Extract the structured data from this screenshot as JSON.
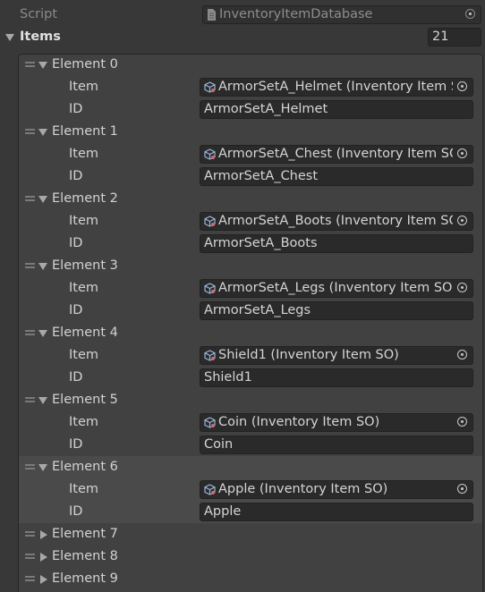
{
  "script": {
    "label": "Script",
    "value": "InventoryItemDatabase"
  },
  "items": {
    "label": "Items",
    "count": "21"
  },
  "elements": [
    {
      "header": "Element 0",
      "item_label": "Item",
      "item_value": "ArmorSetA_Helmet (Inventory Item SO)",
      "id_label": "ID",
      "id_value": "ArmorSetA_Helmet",
      "expanded": true
    },
    {
      "header": "Element 1",
      "item_label": "Item",
      "item_value": "ArmorSetA_Chest (Inventory Item SO)",
      "id_label": "ID",
      "id_value": "ArmorSetA_Chest",
      "expanded": true
    },
    {
      "header": "Element 2",
      "item_label": "Item",
      "item_value": "ArmorSetA_Boots (Inventory Item SO)",
      "id_label": "ID",
      "id_value": "ArmorSetA_Boots",
      "expanded": true
    },
    {
      "header": "Element 3",
      "item_label": "Item",
      "item_value": "ArmorSetA_Legs (Inventory Item SO)",
      "id_label": "ID",
      "id_value": "ArmorSetA_Legs",
      "expanded": true
    },
    {
      "header": "Element 4",
      "item_label": "Item",
      "item_value": "Shield1 (Inventory Item SO)",
      "id_label": "ID",
      "id_value": "Shield1",
      "expanded": true
    },
    {
      "header": "Element 5",
      "item_label": "Item",
      "item_value": "Coin (Inventory Item SO)",
      "id_label": "ID",
      "id_value": "Coin",
      "expanded": true
    },
    {
      "header": "Element 6",
      "item_label": "Item",
      "item_value": "Apple (Inventory Item SO)",
      "id_label": "ID",
      "id_value": "Apple",
      "expanded": true,
      "selected": true
    },
    {
      "header": "Element 7",
      "expanded": false
    },
    {
      "header": "Element 8",
      "expanded": false
    },
    {
      "header": "Element 9",
      "expanded": false
    }
  ],
  "icons": {
    "script": "script-asset-icon",
    "object": "scriptable-object-icon",
    "picker": "object-picker-icon"
  },
  "colors": {
    "panel": "#383838",
    "list_bg": "#414141",
    "field_bg": "#2a2a2a",
    "selected_bg": "#4a4a4a",
    "text": "#d2d2d2"
  }
}
